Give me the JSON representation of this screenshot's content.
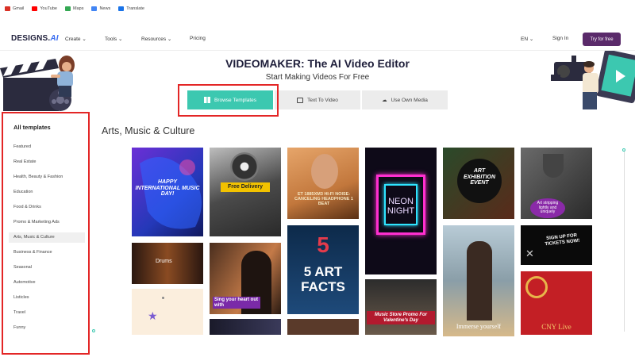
{
  "bookmarks": [
    {
      "label": "Gmail",
      "color": "#d93025"
    },
    {
      "label": "YouTube",
      "color": "#ff0000"
    },
    {
      "label": "Maps",
      "color": "#34a853"
    },
    {
      "label": "News",
      "color": "#4285f4"
    },
    {
      "label": "Translate",
      "color": "#1a73e8"
    }
  ],
  "nav": {
    "logo_main": "DESIGNS.",
    "logo_ai": "AI",
    "items": [
      "Create",
      "Tools",
      "Resources",
      "Pricing"
    ],
    "language": "EN",
    "signin": "Sign In",
    "try_free": "Try for free"
  },
  "hero": {
    "title": "VIDEOMAKER: The AI Video Editor",
    "subtitle": "Start Making Videos For Free",
    "tabs": [
      "Browse Templates",
      "Text To Video",
      "Use Own Media"
    ]
  },
  "sidebar": {
    "heading": "All templates",
    "items": [
      "Featured",
      "Real Estate",
      "Health, Beauty & Fashion",
      "Education",
      "Food & Drinks",
      "Promo & Marketing Ads",
      "Arts, Music & Culture",
      "Business & Finance",
      "Seasonal",
      "Automotive",
      "Listicles",
      "Travel",
      "Funny"
    ],
    "active_index": 6
  },
  "content": {
    "section_title": "Arts, Music & Culture",
    "templates": {
      "t1": "HAPPY INTERNATIONAL MUSIC DAY!",
      "t2": "Free Delivery",
      "t3": "ET 1885XM3 HI-FI NOISE-CANCELING HEADPHONE 1 BEAT",
      "t4": "NEON NIGHT",
      "t5": "ART EXHIBITION EVENT",
      "t6": "Art stripping lightly and uniquely",
      "t7": "Drums",
      "t8": "Sing your heart out with",
      "t9": "5 ART FACTS",
      "t10": "Music Store Promo For Valentine's Day",
      "t11": "Immerse yourself",
      "t12": "SIGN UP FOR TICKETS NOW!",
      "t13": "CNY Live"
    }
  },
  "colors": {
    "accent": "#3cc8b0",
    "brand": "#5a2a6a",
    "highlight": "#e32626"
  }
}
